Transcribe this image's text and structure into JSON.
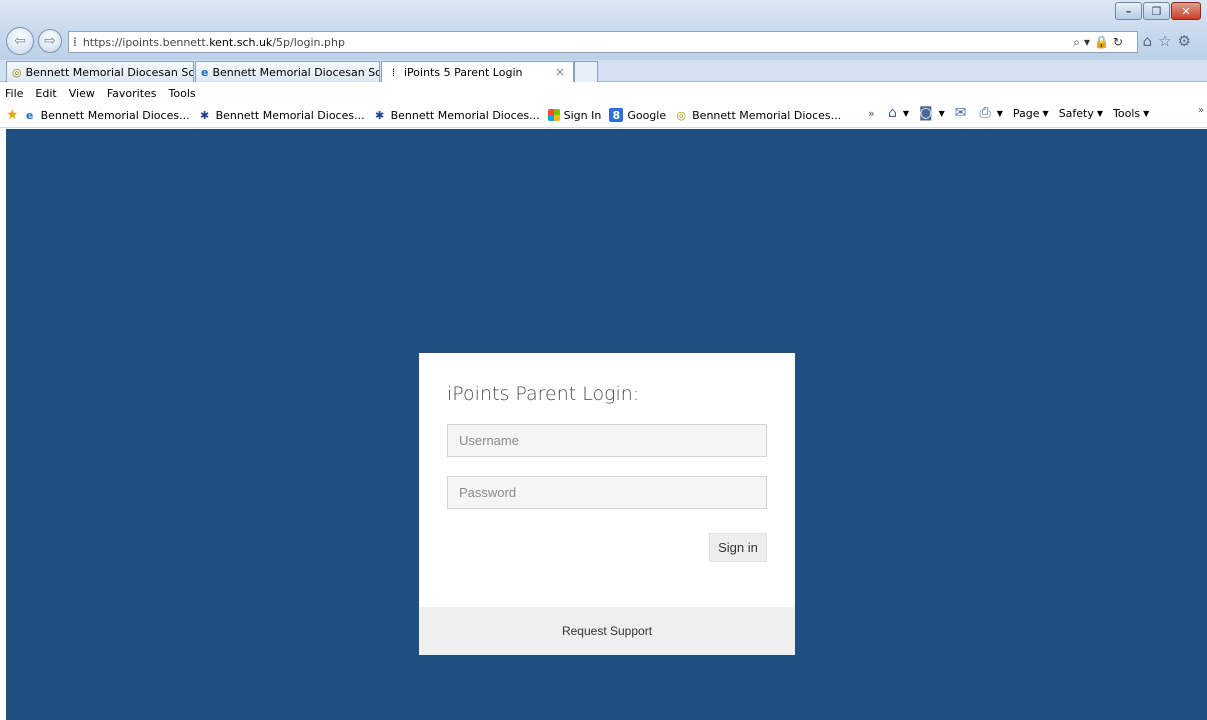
{
  "browser": {
    "url_prefix": "https://ipoints.bennett.",
    "url_domain": "kent.sch.uk",
    "url_path": "/5p/login.php",
    "tabs": [
      {
        "label": "Bennett Memorial Diocesan Sc...",
        "icon": "swirl-icon"
      },
      {
        "label": "Bennett Memorial Diocesan Sc...",
        "icon": "ie-icon"
      },
      {
        "label": "iPoints 5 Parent Login",
        "icon": "site-icon",
        "active": true
      }
    ],
    "menu": [
      "File",
      "Edit",
      "View",
      "Favorites",
      "Tools"
    ],
    "favorites": [
      {
        "label": "Bennett Memorial Dioces...",
        "icon": "ie-icon"
      },
      {
        "label": "Bennett Memorial Dioces...",
        "icon": "bug-icon"
      },
      {
        "label": "Bennett Memorial Dioces...",
        "icon": "bug-icon"
      },
      {
        "label": "Sign In",
        "icon": "microsoft-icon"
      },
      {
        "label": "Google",
        "icon": "google-icon"
      },
      {
        "label": "Bennett Memorial Dioces...",
        "icon": "swirl-icon"
      }
    ],
    "commands": {
      "page": "Page",
      "safety": "Safety",
      "tools": "Tools"
    }
  },
  "login": {
    "title": "iPoints Parent Login:",
    "username_placeholder": "Username",
    "password_placeholder": "Password",
    "signin_label": "Sign in",
    "support_label": "Request Support"
  },
  "colors": {
    "page_background": "#204f81",
    "card_background": "#ffffff",
    "footer_background": "#efefef"
  }
}
